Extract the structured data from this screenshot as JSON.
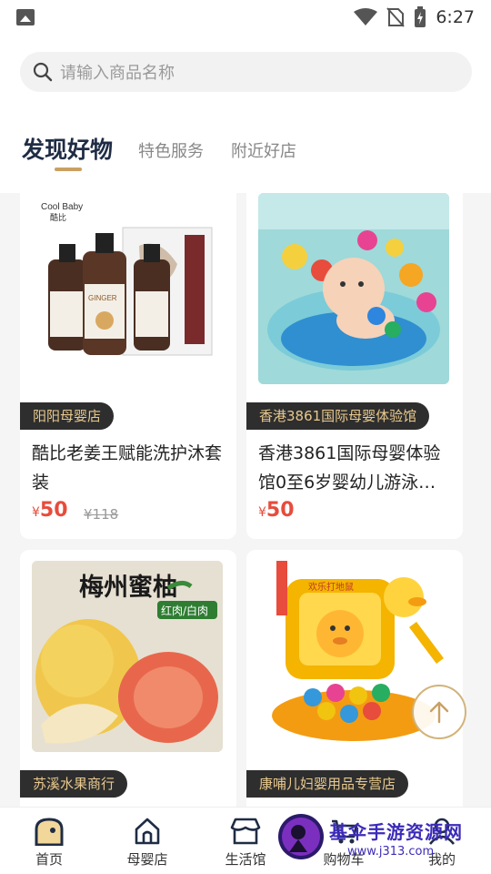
{
  "status_bar": {
    "time": "6:27"
  },
  "search": {
    "placeholder": "请输入商品名称"
  },
  "tabs": [
    {
      "label": "发现好物"
    },
    {
      "label": "特色服务"
    },
    {
      "label": "附近好店"
    }
  ],
  "products": [
    {
      "brand_en": "Cool Baby",
      "brand_cn": "酷比",
      "bottle_label": "GINGER",
      "shop": "阳阳母婴店",
      "title": "酷比老姜王赋能洗护沐套装",
      "currency": "¥",
      "price": "50",
      "original_price": "¥118"
    },
    {
      "shop": "香港3861国际母婴体验馆",
      "title": "香港3861国际母婴体验馆0至6岁婴幼儿游泳…",
      "currency": "¥",
      "price": "50"
    },
    {
      "image_heading": "梅州蜜柚",
      "image_badge": "红肉/白肉",
      "shop": "苏溪水果商行"
    },
    {
      "toy_label": "欢乐打地鼠",
      "shop": "康哺儿妇婴用品专营店"
    }
  ],
  "bottom_nav": [
    {
      "label": "首页",
      "icon": "home-icon"
    },
    {
      "label": "母婴店",
      "icon": "shop-icon"
    },
    {
      "label": "生活馆",
      "icon": "store-icon"
    },
    {
      "label": "购物车",
      "icon": "cart-icon"
    },
    {
      "label": "我的",
      "icon": "profile-icon"
    }
  ],
  "watermark": {
    "title": "基伞手游资源网",
    "url": "www.j313.com"
  },
  "colors": {
    "accent": "#c9a063",
    "price": "#e74c3c",
    "tab_active": "#1f2c44",
    "tag_bg": "#2e2e2e",
    "tag_text": "#e9c98e"
  }
}
